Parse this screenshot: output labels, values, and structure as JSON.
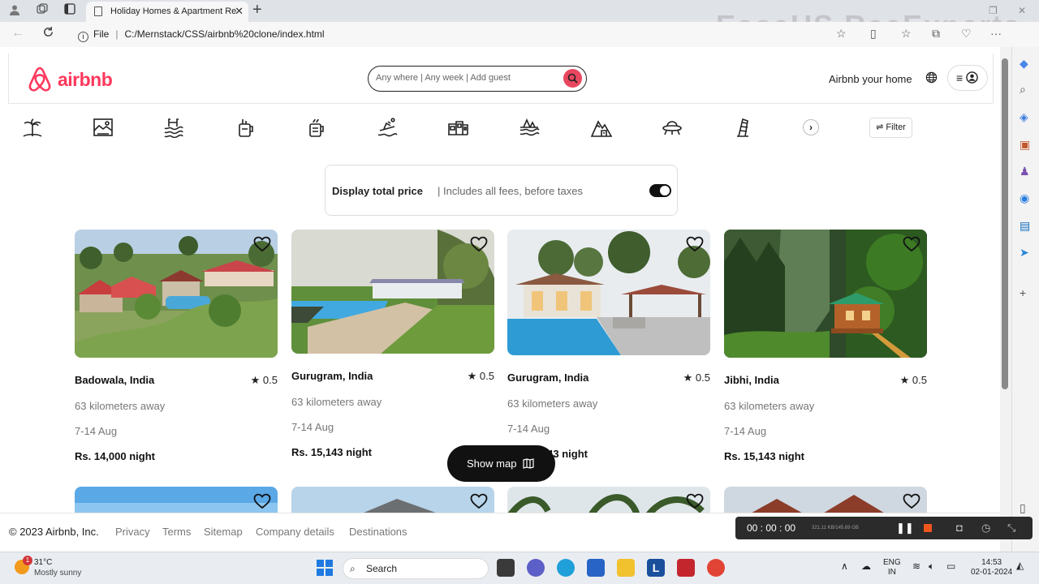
{
  "browser": {
    "tab_title": "Holiday Homes & Apartment Re",
    "url_scheme": "File",
    "url": "C:/Mernstack/CSS/airbnb%20clone/index.html",
    "watermark": "EaseUS RecExperts"
  },
  "header": {
    "logo_text": "airbnb",
    "search_placeholder": "Any where | Any week | Add guest",
    "host_label": "Airbnb your home"
  },
  "categories": [
    "palm-tree-icon",
    "lake-frame-icon",
    "pool-icon",
    "tea-mug-icon",
    "coffee-mug-icon",
    "surfing-icon",
    "house-row-icon",
    "island-boat-icon",
    "mountain-house-icon",
    "ufo-icon",
    "leaning-tower-icon"
  ],
  "filter_label": "Filter",
  "total_price": {
    "title": "Display total price",
    "subtitle": "| Includes all fees, before taxes",
    "enabled": true
  },
  "listings": [
    {
      "location": "Badowala, India",
      "rating": "0.5",
      "distance": "63 kilometers away",
      "dates": "7-14 Aug",
      "price": "Rs. 14,000 night"
    },
    {
      "location": "Gurugram, India",
      "rating": "0.5",
      "distance": "63 kilometers away",
      "dates": "7-14 Aug",
      "price": "Rs. 15,143 night"
    },
    {
      "location": "Gurugram, India",
      "rating": "0.5",
      "distance": "63 kilometers away",
      "dates": "7-14 Aug",
      "price": "Rs. 15,143 night"
    },
    {
      "location": "Jibhi, India",
      "rating": "0.5",
      "distance": "63 kilometers away",
      "dates": "7-14 Aug",
      "price": "Rs. 15,143 night"
    }
  ],
  "show_map_label": "Show map",
  "footer": {
    "copyright": "© 2023 Airbnb, Inc.",
    "links": [
      "Privacy",
      "Terms",
      "Sitemap",
      "Company details",
      "Destinations"
    ]
  },
  "recorder": {
    "time": "00 : 00 : 00",
    "size": "321.11 KB/145.69 GB"
  },
  "taskbar": {
    "temperature": "31°C",
    "weather": "Mostly sunny",
    "weather_badge": "1",
    "search_label": "Search",
    "lang_top": "ENG",
    "lang_bottom": "IN",
    "time": "14:53",
    "date": "02-01-2024"
  },
  "colors": {
    "brand": "#ff385c",
    "accent_search": "#e8475f"
  }
}
